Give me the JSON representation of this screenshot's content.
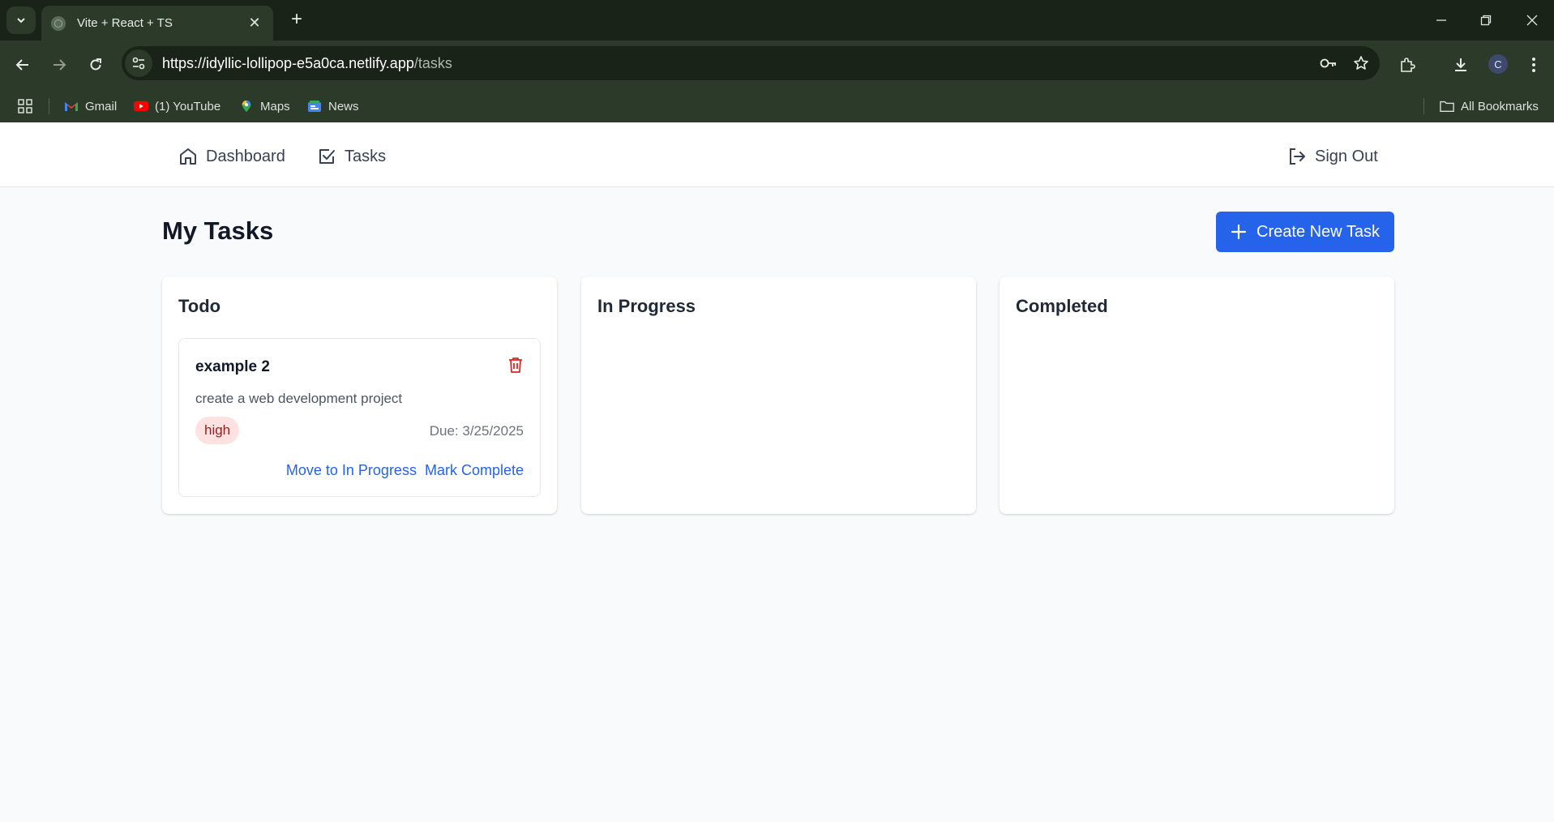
{
  "browser": {
    "tab_title": "Vite + React + TS",
    "url_host": "https://idyllic-lollipop-e5a0ca.netlify.app",
    "url_path": "/tasks",
    "profile_initial": "C",
    "bookmarks": [
      {
        "label": "Gmail",
        "icon": "gmail-icon"
      },
      {
        "label": "(1) YouTube",
        "icon": "youtube-icon"
      },
      {
        "label": "Maps",
        "icon": "maps-icon"
      },
      {
        "label": "News",
        "icon": "news-icon"
      }
    ],
    "all_bookmarks_label": "All Bookmarks"
  },
  "nav": {
    "dashboard_label": "Dashboard",
    "tasks_label": "Tasks",
    "sign_out_label": "Sign Out"
  },
  "page": {
    "title": "My Tasks",
    "create_button_label": "Create New Task"
  },
  "columns": [
    {
      "title": "Todo",
      "tasks": [
        {
          "title": "example 2",
          "description": "create a web development project",
          "priority": "high",
          "due": "Due: 3/25/2025",
          "actions": [
            "Move to In Progress",
            "Mark Complete"
          ]
        }
      ]
    },
    {
      "title": "In Progress",
      "tasks": []
    },
    {
      "title": "Completed",
      "tasks": []
    }
  ],
  "colors": {
    "primary": "#2563eb",
    "priority_high_bg": "#fee2e2",
    "priority_high_text": "#991b1b",
    "delete_icon": "#dc2626"
  }
}
